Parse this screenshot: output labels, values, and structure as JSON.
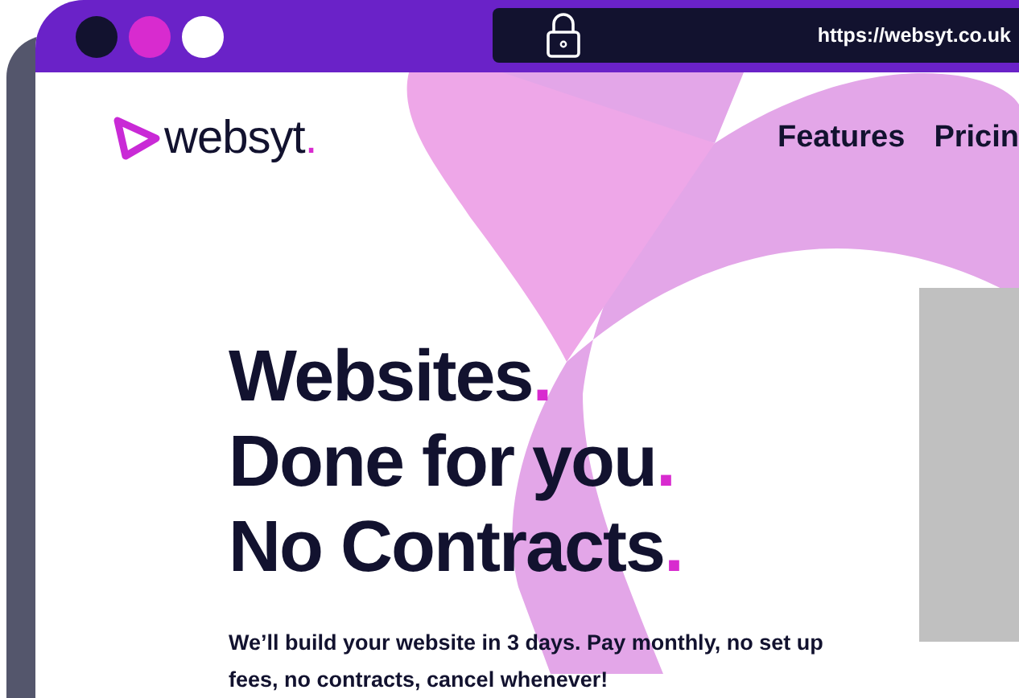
{
  "browser": {
    "url": "https://websyt.co.uk"
  },
  "site": {
    "logo": "websyt",
    "logo_dot": ".",
    "nav": [
      "Features",
      "Pricin"
    ]
  },
  "hero": {
    "headline": [
      {
        "text": "Websites",
        "dot": "."
      },
      {
        "text": "Done for you",
        "dot": "."
      },
      {
        "text": "No Contracts",
        "dot": "."
      }
    ],
    "paragraph": "We’ll build your website in 3 days. Pay monthly, no set up fees, no contracts, cancel whenever!"
  }
}
